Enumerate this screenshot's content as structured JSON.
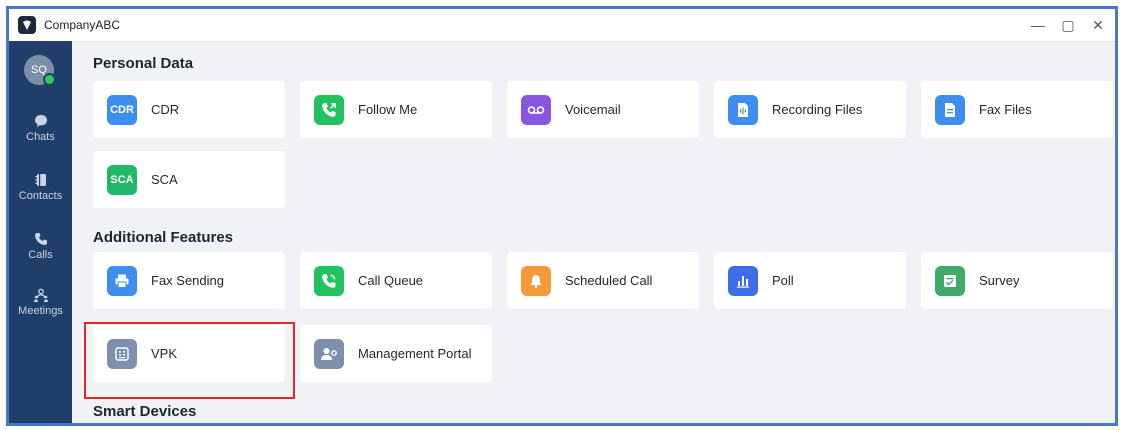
{
  "app": {
    "title": "CompanyABC"
  },
  "window_controls": {
    "minimize": "—",
    "maximize": "▢",
    "close": "✕"
  },
  "user": {
    "initials": "SQ"
  },
  "sidebar": {
    "items": [
      {
        "label": "Chats",
        "icon": "chat-bubble-icon"
      },
      {
        "label": "Contacts",
        "icon": "contacts-book-icon"
      },
      {
        "label": "Calls",
        "icon": "phone-icon"
      },
      {
        "label": "Meetings",
        "icon": "people-icon"
      }
    ]
  },
  "sections": {
    "personal": {
      "title": "Personal Data",
      "items": [
        {
          "label": "CDR",
          "badge": "CDR",
          "icon": "cdr-text-icon",
          "color": "#3d8ef0"
        },
        {
          "label": "Follow Me",
          "badge": "",
          "icon": "phone-forward-icon",
          "color": "#22c35e"
        },
        {
          "label": "Voicemail",
          "badge": "",
          "icon": "voicemail-icon",
          "color": "#8a55e0"
        },
        {
          "label": "Recording Files",
          "badge": "",
          "icon": "audio-file-icon",
          "color": "#3d8ef0"
        },
        {
          "label": "Fax Files",
          "badge": "",
          "icon": "document-icon",
          "color": "#3d8ef0"
        },
        {
          "label": "SCA",
          "badge": "SCA",
          "icon": "sca-text-icon",
          "color": "#22b86a"
        }
      ]
    },
    "additional": {
      "title": "Additional Features",
      "items": [
        {
          "label": "Fax Sending",
          "badge": "",
          "icon": "printer-icon",
          "color": "#3d8ef0"
        },
        {
          "label": "Call Queue",
          "badge": "",
          "icon": "call-queue-icon",
          "color": "#22c35e"
        },
        {
          "label": "Scheduled Call",
          "badge": "",
          "icon": "bell-icon",
          "color": "#f59a3a"
        },
        {
          "label": "Poll",
          "badge": "",
          "icon": "bar-chart-icon",
          "color": "#3d6ee8"
        },
        {
          "label": "Survey",
          "badge": "",
          "icon": "survey-icon",
          "color": "#3eab6a"
        },
        {
          "label": "VPK",
          "badge": "",
          "icon": "keypad-icon",
          "color": "#7f8fae"
        },
        {
          "label": "Management Portal",
          "badge": "",
          "icon": "admin-user-icon",
          "color": "#7f8fae"
        }
      ]
    },
    "smart": {
      "title": "Smart Devices"
    }
  }
}
